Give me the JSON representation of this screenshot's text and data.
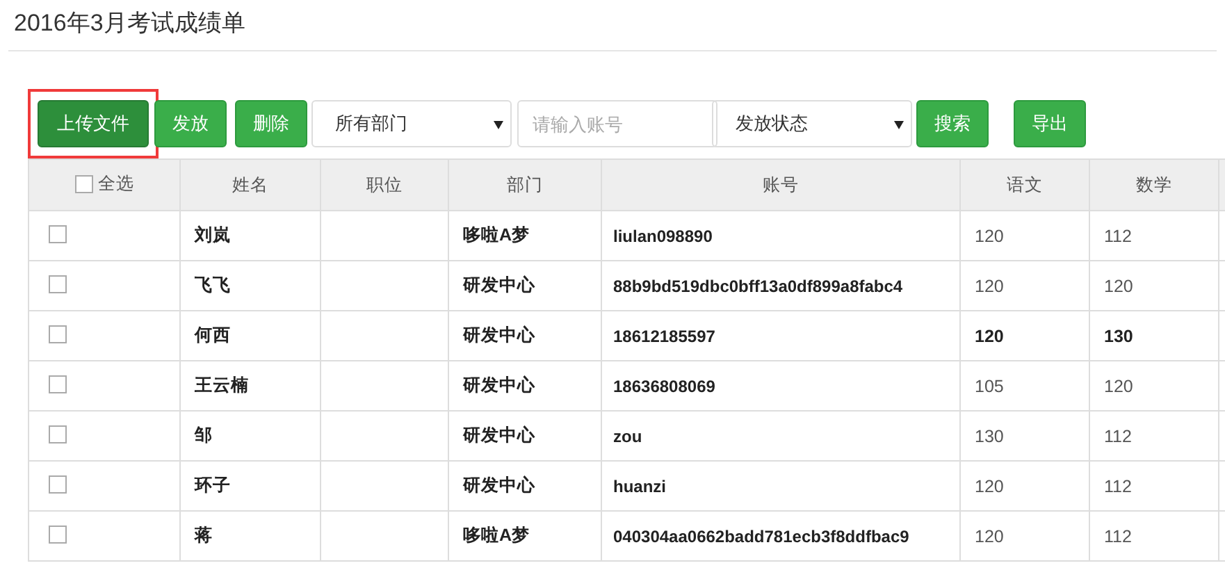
{
  "page_title": "2016年3月考试成绩单",
  "toolbar": [
    {
      "kind": "button",
      "label": "上传文件",
      "pressed": true,
      "highlighted": true
    },
    {
      "kind": "button",
      "label": "发放",
      "pressed": false,
      "highlighted": false
    },
    {
      "kind": "button",
      "label": "删除",
      "pressed": false,
      "highlighted": false
    },
    {
      "kind": "select",
      "value": "所有部门"
    },
    {
      "kind": "input",
      "placeholder": "请输入账号"
    },
    {
      "kind": "select",
      "value": "发放状态"
    },
    {
      "kind": "button",
      "label": "搜索",
      "pressed": false,
      "highlighted": false
    },
    {
      "kind": "button",
      "label": "导出",
      "pressed": false,
      "highlighted": false
    }
  ],
  "table": {
    "select_all": {
      "label": "全选",
      "checked": false
    },
    "columns": [
      "姓名",
      "职位",
      "部门",
      "账号",
      "语文",
      "数学"
    ],
    "rows": [
      {
        "checked": false,
        "name": "刘岚",
        "department": "哆啦A梦",
        "account": "liulan098890",
        "chinese": "120",
        "math": "112",
        "scores_bold": false
      },
      {
        "checked": false,
        "name": "飞飞",
        "department": "研发中心",
        "account": "88b9bd519dbc0bff13a0df899a8fabc4",
        "chinese": "120",
        "math": "120",
        "scores_bold": false
      },
      {
        "checked": false,
        "name": "何西",
        "department": "研发中心",
        "account": "18612185597",
        "chinese": "120",
        "math": "130",
        "scores_bold": true
      },
      {
        "checked": false,
        "name": "王云楠",
        "department": "研发中心",
        "account": "18636808069",
        "chinese": "105",
        "math": "120",
        "scores_bold": false
      },
      {
        "checked": false,
        "name": "邹",
        "department": "研发中心",
        "account": "zou",
        "chinese": "130",
        "math": "112",
        "scores_bold": false
      },
      {
        "checked": false,
        "name": "环子",
        "department": "研发中心",
        "account": "huanzi",
        "chinese": "120",
        "math": "112",
        "scores_bold": false
      },
      {
        "checked": false,
        "name": "蒋",
        "department": "哆啦A梦",
        "account": "040304aa0662badd781ecb3f8ddfbac9",
        "chinese": "120",
        "math": "112",
        "scores_bold": false
      }
    ]
  }
}
